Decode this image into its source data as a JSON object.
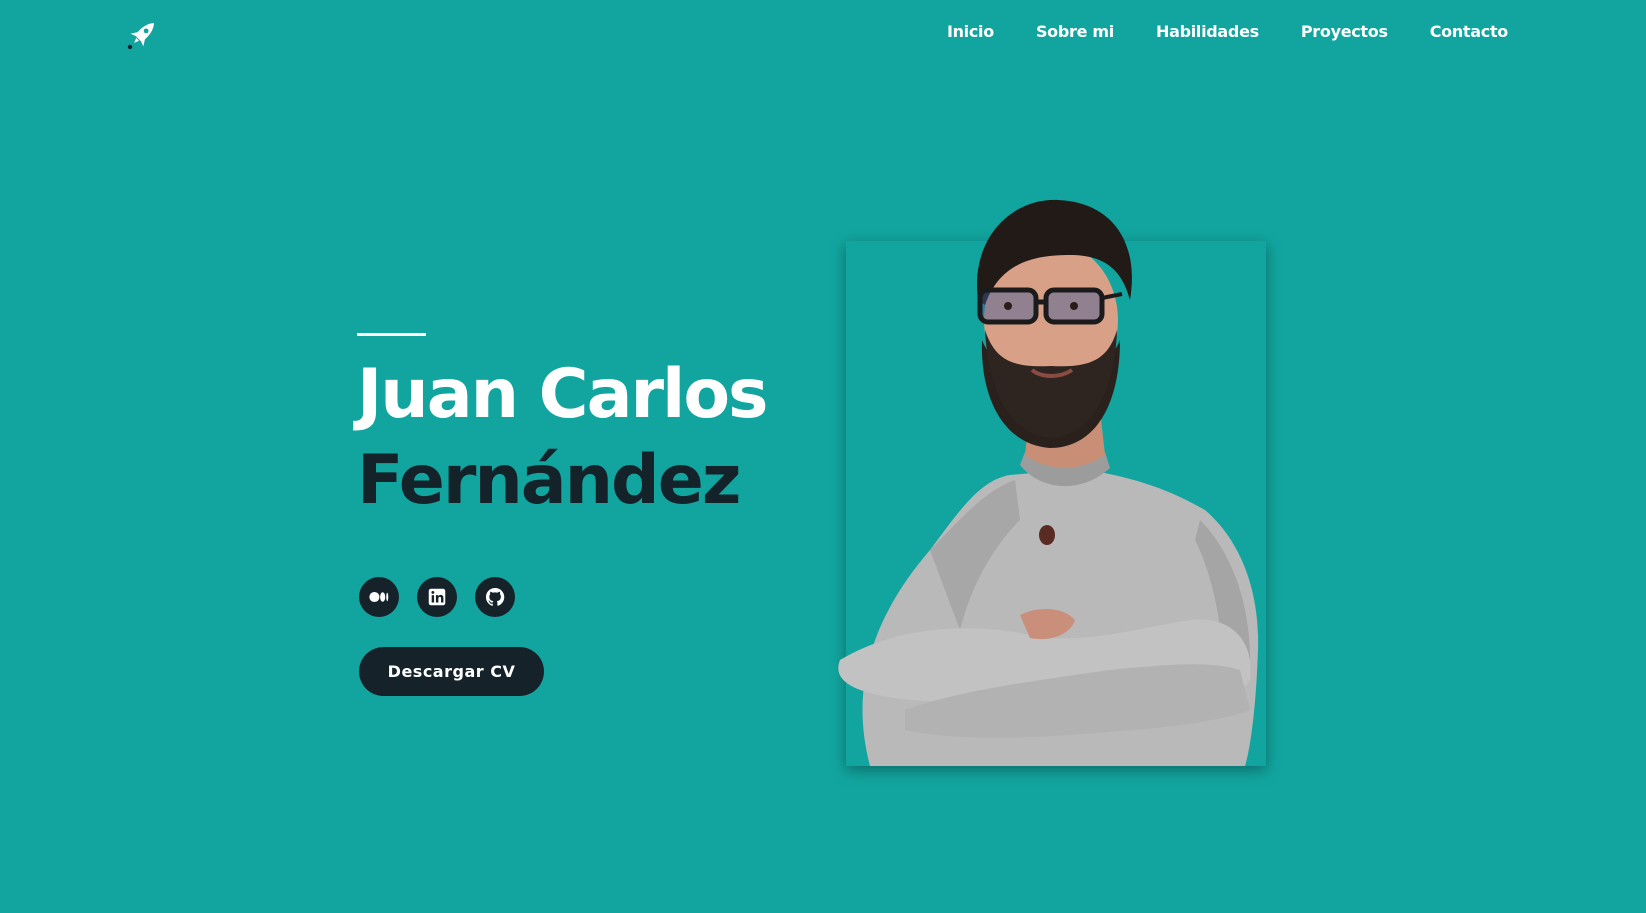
{
  "header": {
    "logo_icon": "rocket-icon",
    "nav": [
      {
        "label": "Inicio"
      },
      {
        "label": "Sobre mi"
      },
      {
        "label": "Habilidades"
      },
      {
        "label": "Proyectos"
      },
      {
        "label": "Contacto"
      }
    ]
  },
  "hero": {
    "first_name": "Juan Carlos",
    "last_name": "Fernández",
    "socials": [
      {
        "icon": "medium-icon"
      },
      {
        "icon": "linkedin-icon"
      },
      {
        "icon": "github-icon"
      }
    ],
    "cv_button": "Descargar CV"
  },
  "colors": {
    "background": "#12a59f",
    "dark": "#162229",
    "text_light": "#ffffff"
  }
}
